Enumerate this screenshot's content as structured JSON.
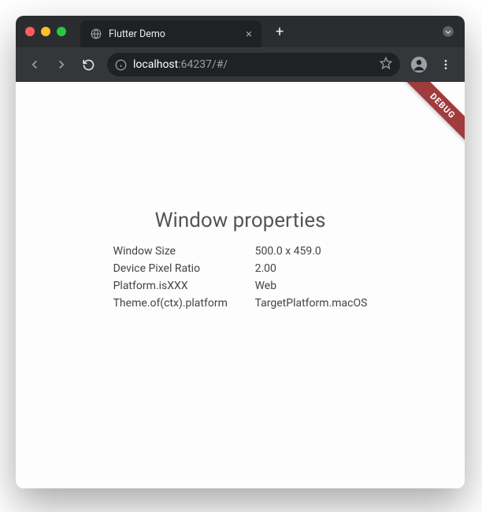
{
  "browser": {
    "tab_title": "Flutter Demo",
    "url": {
      "host": "localhost",
      "rest": ":64237/#/"
    }
  },
  "debug_banner": "DEBUG",
  "page": {
    "title": "Window properties",
    "rows": [
      {
        "label": "Window Size",
        "value": "500.0 x 459.0"
      },
      {
        "label": "Device Pixel Ratio",
        "value": "2.00"
      },
      {
        "label": "Platform.isXXX",
        "value": "Web"
      },
      {
        "label": "Theme.of(ctx).platform",
        "value": "TargetPlatform.macOS"
      }
    ]
  }
}
